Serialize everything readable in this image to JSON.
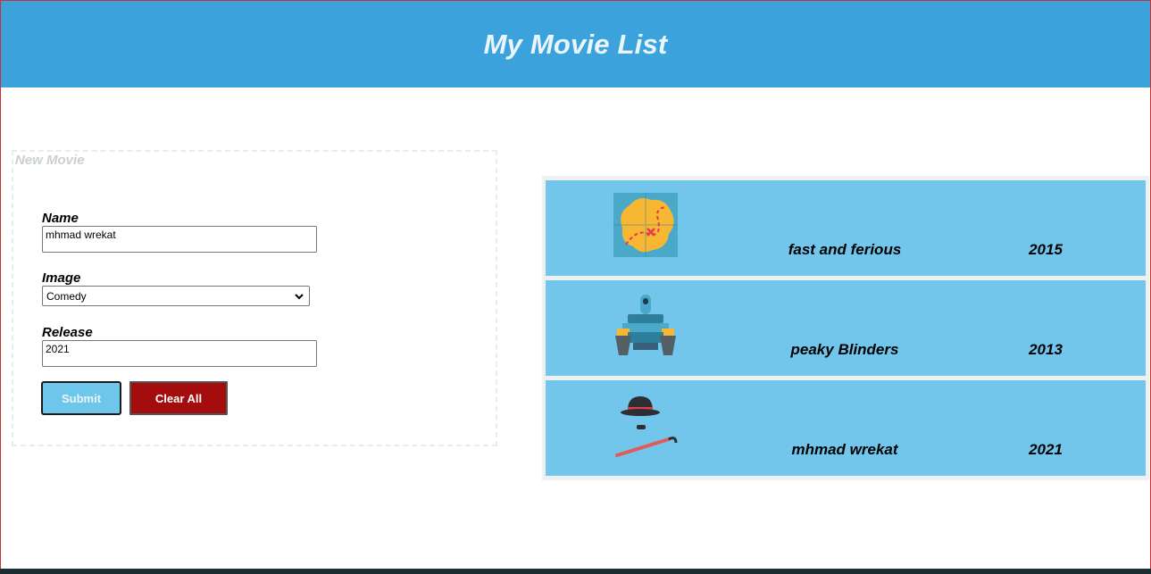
{
  "header": {
    "title": "My Movie List"
  },
  "form": {
    "legend": "New Movie",
    "name_label": "Name",
    "name_value": "mhmad wrekat",
    "image_label": "Image",
    "image_selected": "Comedy",
    "release_label": "Release",
    "release_value": "2021",
    "submit_label": "Submit",
    "clear_label": "Clear All"
  },
  "movies": [
    {
      "icon": "treasure-map-icon",
      "name": "fast and ferious",
      "year": "2015"
    },
    {
      "icon": "tank-icon",
      "name": "peaky Blinders",
      "year": "2013"
    },
    {
      "icon": "comedy-hat-cane-icon",
      "name": "mhmad wrekat",
      "year": "2021"
    }
  ],
  "colors": {
    "header_bg": "#3ba2db",
    "row_bg": "#72c6ec",
    "submit_bg": "#6ec6ea",
    "clear_bg": "#a30d0d"
  }
}
